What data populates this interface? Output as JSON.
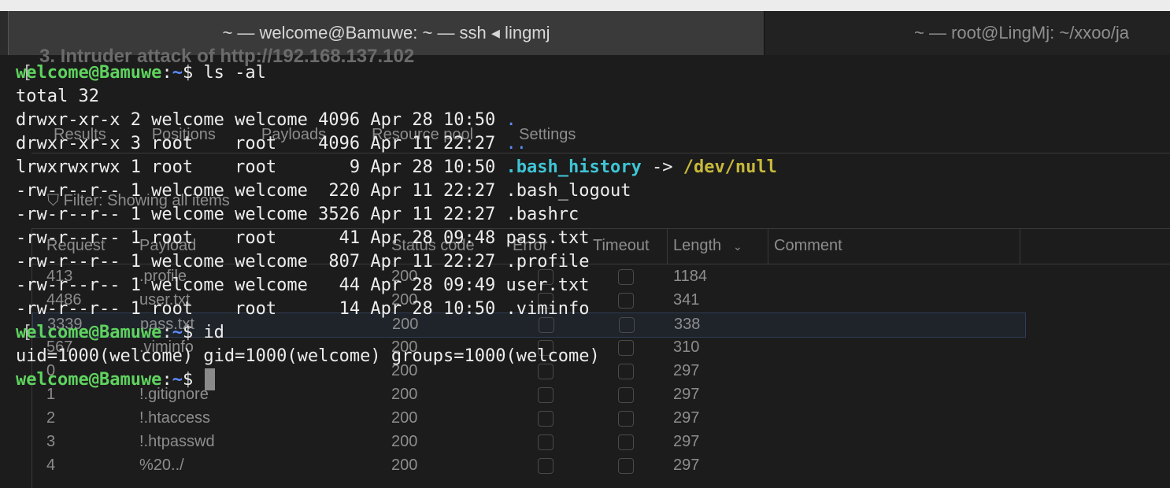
{
  "window": {
    "tabs": [
      {
        "label": "~ — welcome@Bamuwe: ~ — ssh ◂ lingmj",
        "active": true
      },
      {
        "label": "~ — root@LingMj: ~/xxoo/ja",
        "active": false
      }
    ]
  },
  "background_app": {
    "title": "3. Intruder attack of http://192.168.137.102",
    "tabs": [
      "Results",
      "Positions",
      "Payloads",
      "Resource pool",
      "Settings"
    ],
    "filter": "Filter: Showing all items",
    "columns": [
      "Request",
      "Payload",
      "Status code",
      "Error",
      "Timeout",
      "Length",
      "Comment"
    ],
    "sort_icon": "chevron-down-icon",
    "rows": [
      {
        "request": "413",
        "payload": ".profile",
        "status": "200",
        "length": "1184"
      },
      {
        "request": "4486",
        "payload": "user.txt",
        "status": "200",
        "length": "341"
      },
      {
        "request": "3339",
        "payload": "pass.txt",
        "status": "200",
        "length": "338"
      },
      {
        "request": "567",
        "payload": ".viminfo",
        "status": "200",
        "length": "310"
      },
      {
        "request": "0",
        "payload": "",
        "status": "200",
        "length": "297"
      },
      {
        "request": "1",
        "payload": "!.gitignore",
        "status": "200",
        "length": "297"
      },
      {
        "request": "2",
        "payload": "!.htaccess",
        "status": "200",
        "length": "297"
      },
      {
        "request": "3",
        "payload": "!.htpasswd",
        "status": "200",
        "length": "297"
      },
      {
        "request": "4",
        "payload": "%20../",
        "status": "200",
        "length": "297"
      }
    ]
  },
  "terminal": {
    "prompt_user": "welcome@Bamuwe",
    "prompt_sep": ":",
    "prompt_path": "~",
    "prompt_symbol": "$",
    "commands": [
      "ls -al",
      "id"
    ],
    "ls_total": "total 32",
    "ls_rows": [
      {
        "prefix": "drwxr-xr-x 2 welcome welcome 4096 Apr 28 10:50 ",
        "name": ".",
        "kind": "dir"
      },
      {
        "prefix": "drwxr-xr-x 3 root    root    4096 Apr 11 22:27 ",
        "name": "..",
        "kind": "dir"
      },
      {
        "prefix": "lrwxrwxrwx 1 root    root       9 Apr 28 10:50 ",
        "name": ".bash_history",
        "kind": "link",
        "arrow": " -> ",
        "target": "/dev/null"
      },
      {
        "prefix": "-rw-r--r-- 1 welcome welcome  220 Apr 11 22:27 ",
        "name": ".bash_logout",
        "kind": "file"
      },
      {
        "prefix": "-rw-r--r-- 1 welcome welcome 3526 Apr 11 22:27 ",
        "name": ".bashrc",
        "kind": "file"
      },
      {
        "prefix": "-rw-r--r-- 1 root    root      41 Apr 28 09:48 ",
        "name": "pass.txt",
        "kind": "file"
      },
      {
        "prefix": "-rw-r--r-- 1 welcome welcome  807 Apr 11 22:27 ",
        "name": ".profile",
        "kind": "file"
      },
      {
        "prefix": "-rw-r--r-- 1 welcome welcome   44 Apr 28 09:49 ",
        "name": "user.txt",
        "kind": "file"
      },
      {
        "prefix": "-rw-r--r-- 1 root    root      14 Apr 28 10:50 ",
        "name": ".viminfo",
        "kind": "file"
      }
    ],
    "id_output": "uid=1000(welcome) gid=1000(welcome) groups=1000(welcome)",
    "colors": {
      "user": "#5fd35f",
      "path": "#5c8dff",
      "link": "#3fc5d5",
      "link_target": "#c8b93b",
      "text": "#ededed",
      "background": "#1c1c1c"
    }
  }
}
